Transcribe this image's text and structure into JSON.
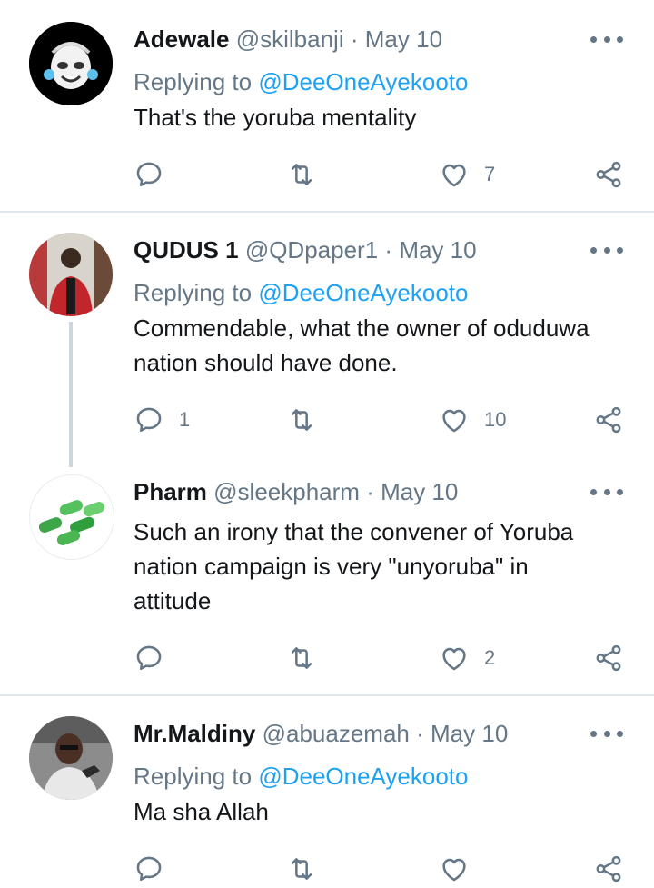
{
  "tweets": [
    {
      "name": "Adewale",
      "handle": "@skilbanji",
      "sep": "·",
      "date": "May 10",
      "replying_prefix": "Replying to ",
      "replying_to": "@DeeOneAyekooto",
      "text": "That's the yoruba mentality",
      "reply_count": "",
      "retweet_count": "",
      "like_count": "7"
    },
    {
      "name": "QUDUS 1",
      "handle": "@QDpaper1",
      "sep": "·",
      "date": "May 10",
      "replying_prefix": "Replying to ",
      "replying_to": "@DeeOneAyekooto",
      "text_lines": [
        "Commendable, what the owner of oduduwa",
        "nation should have done."
      ],
      "reply_count": "1",
      "retweet_count": "",
      "like_count": "10"
    },
    {
      "name": "Pharm",
      "handle": "@sleekpharm",
      "sep": "·",
      "date": "May 10",
      "text_lines": [
        "Such an irony that the convener of Yoruba",
        "nation campaign is very \"unyoruba\" in",
        "attitude"
      ],
      "reply_count": "",
      "retweet_count": "",
      "like_count": "2"
    },
    {
      "name": "Mr.Maldiny",
      "handle": "@abuazemah",
      "sep": "·",
      "date": "May 10",
      "replying_prefix": "Replying to ",
      "replying_to": "@DeeOneAyekooto",
      "text": "Ma sha Allah",
      "reply_count": "",
      "retweet_count": "",
      "like_count": ""
    }
  ],
  "colors": {
    "text": "#14171a",
    "secondary": "#657786",
    "accent": "#1da1f2",
    "divider": "#e1e8ed"
  },
  "icons": [
    "reply-icon",
    "retweet-icon",
    "like-icon",
    "share-icon",
    "more-icon"
  ]
}
